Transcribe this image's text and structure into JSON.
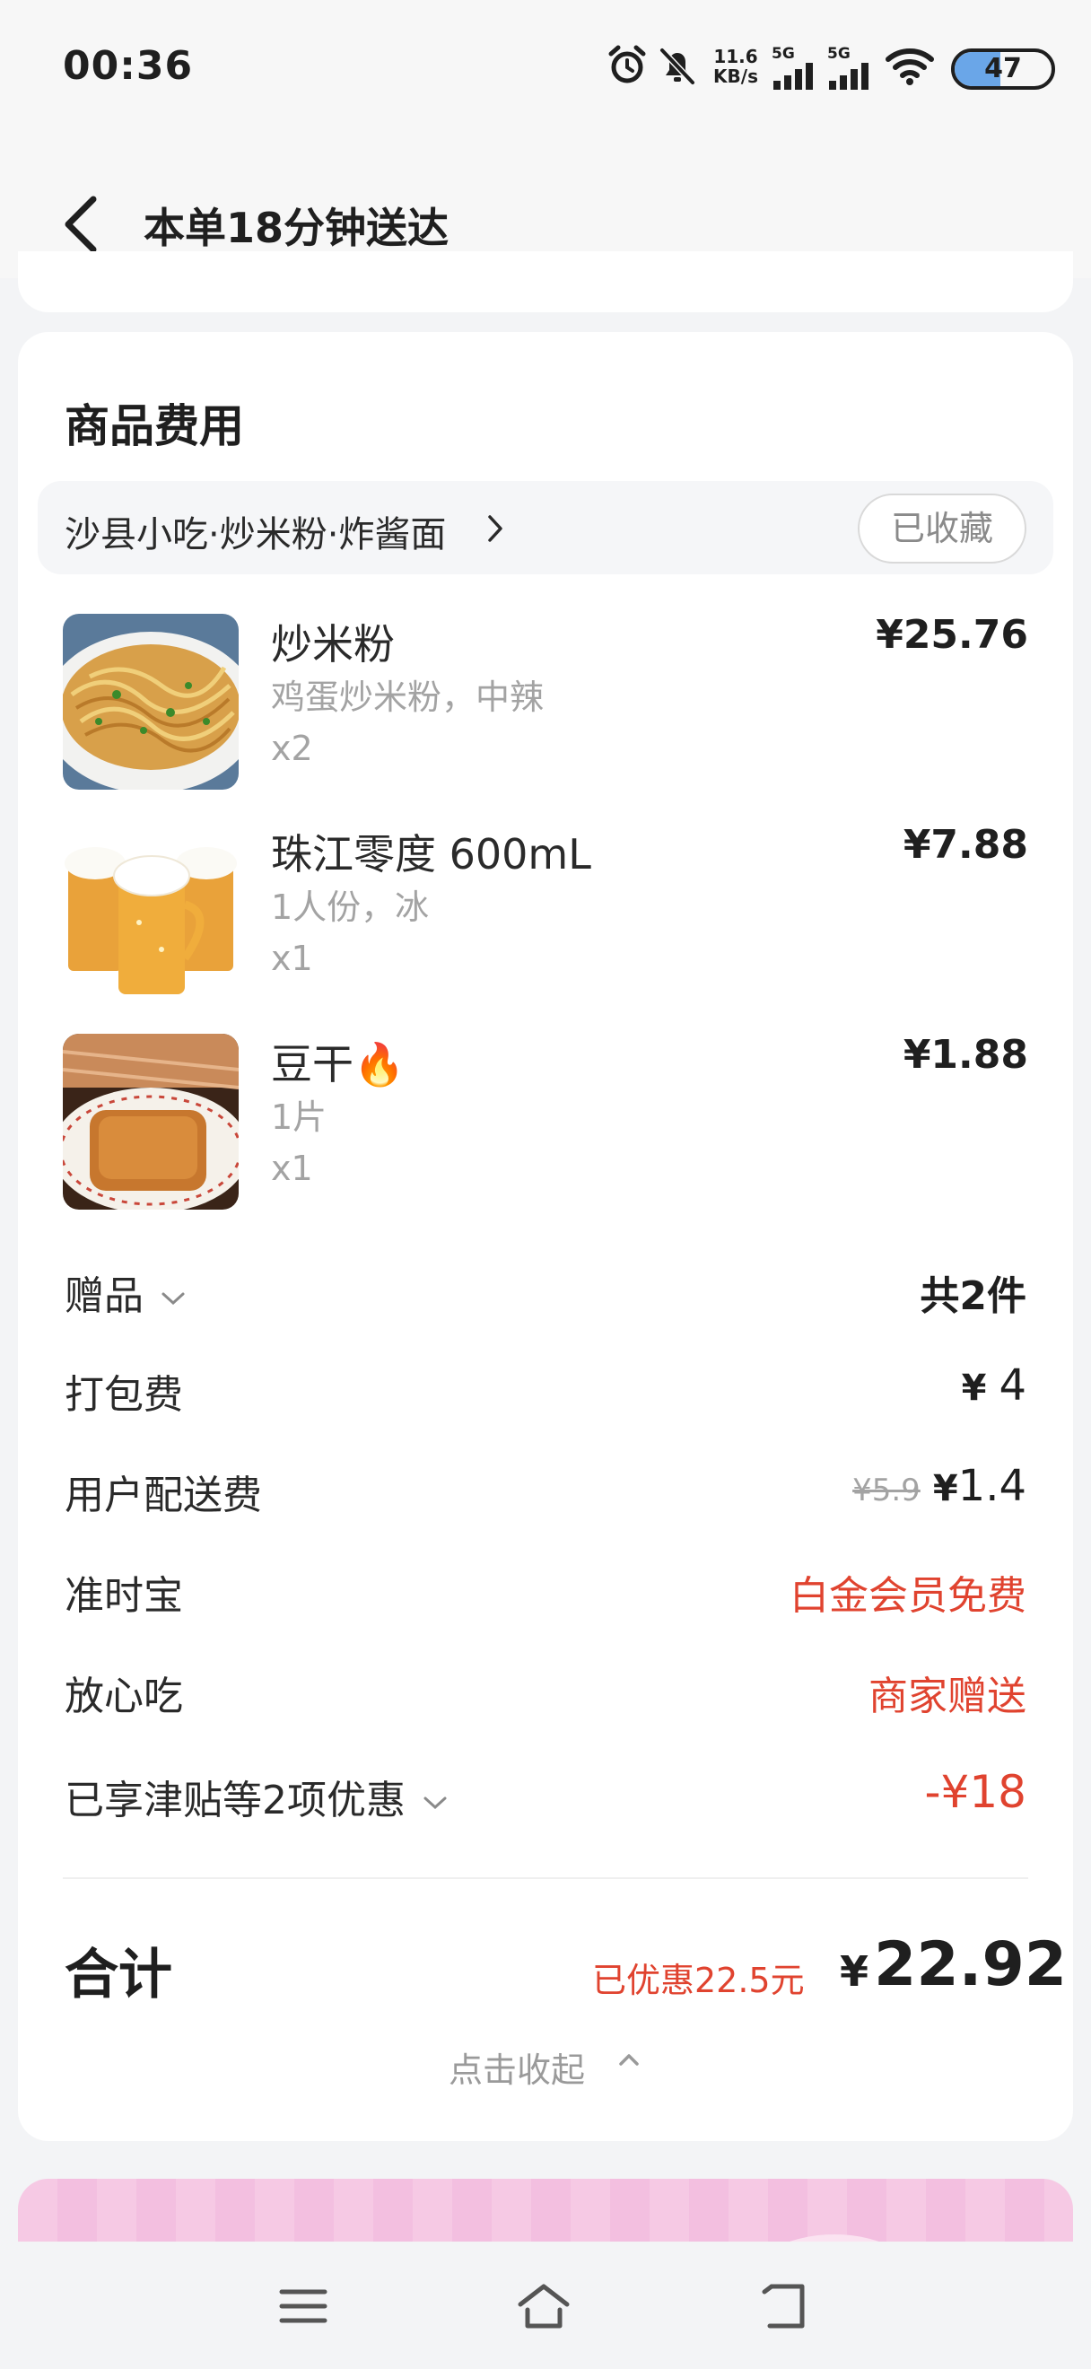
{
  "status_bar": {
    "time": "00:36",
    "net_speed_value": "11.6",
    "net_speed_unit": "KB/s",
    "signal_1_label": "5G",
    "signal_2_label": "5G",
    "battery_level": "47",
    "battery_fraction": 0.47,
    "icons": [
      "alarm-icon",
      "mute-bell-icon",
      "signal-5g-icon",
      "signal-5g-icon",
      "wifi-icon",
      "battery-icon"
    ]
  },
  "header": {
    "title": "本单18分钟送达",
    "back_icon": "chevron-left-icon"
  },
  "fees_card": {
    "title": "商品费用",
    "store": {
      "name": "沙县小吃·炒米粉·炸酱面",
      "favorite_label": "已收藏"
    },
    "items": [
      {
        "name": "炒米粉",
        "spec": "鸡蛋炒米粉，中辣",
        "qty": "x2",
        "price": "¥25.76",
        "image": "fried-rice-noodles-photo"
      },
      {
        "name": "珠江零度 600mL",
        "spec": "1人份，冰",
        "qty": "x1",
        "price": "¥7.88",
        "image": "beer-mugs-photo"
      },
      {
        "name": "豆干",
        "name_emoji": "🔥",
        "spec": "1片",
        "qty": "x1",
        "price": "¥1.88",
        "image": "fried-tofu-photo"
      }
    ],
    "gift": {
      "label": "赠品",
      "value": "共2件"
    },
    "packaging": {
      "label": "打包费",
      "yen": "¥",
      "value": "4"
    },
    "delivery": {
      "label": "用户配送费",
      "original": "¥5.9",
      "yen": "¥",
      "value": "1.4"
    },
    "ontime": {
      "label": "准时宝",
      "value": "白金会员免费"
    },
    "assured": {
      "label": "放心吃",
      "value": "商家赠送"
    },
    "discount": {
      "label": "已享津贴等2项优惠",
      "value": "-¥18"
    },
    "total": {
      "label": "合计",
      "saved": "已优惠22.5元",
      "yen": "¥",
      "amount": "22.92"
    },
    "collapse_label": "点击收起"
  },
  "colors": {
    "accent_red": "#e0432f",
    "muted_gray": "#a3a3a3",
    "card_bg": "#ffffff",
    "page_bg": "#f3f4f6",
    "promo_pink": "#f6c9e4"
  }
}
